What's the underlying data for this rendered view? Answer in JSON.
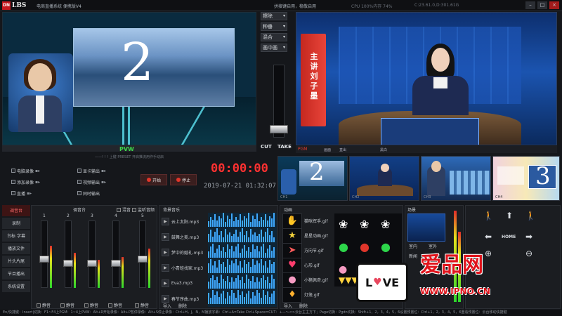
{
  "titlebar": {
    "logo_mark": "DN",
    "logo_text": "LBS",
    "system_name": "电商直播系统 便携版V4",
    "status_text": "拼接键启用，稳敬启用",
    "cpu_text": "CPU 100%内存 74%",
    "clock_text": "C:23.61.0,D:301.61G",
    "minimize": "–",
    "maximize": "□",
    "close": "×"
  },
  "preview": {
    "label": "PVW",
    "number": "2"
  },
  "switcher": {
    "dropdowns": [
      "擦除",
      "种垂",
      "混合",
      "画中画"
    ],
    "cut_label": "CUT",
    "take_label": "TAKE"
  },
  "program": {
    "banner_text": "主讲刘子墨",
    "bar_rec": "PGM",
    "bar_items": [
      "画面",
      "直出",
      "黑白"
    ]
  },
  "controls": {
    "info_line": "——! ! ! 上键 PRESET 开启推流用作手动启",
    "checks_left": [
      "电脑录像",
      "添加录像",
      "直播"
    ],
    "checks_right": [
      "显卡输出",
      "视频输出",
      "同时输出"
    ],
    "record_label": "开始",
    "stop_label": "停止",
    "timer": "00:00:00",
    "datetime": "2019-07-21 01:32:07"
  },
  "thumbnails": {
    "labels": [
      "CH1",
      "CH2",
      "CH3",
      "CH4"
    ],
    "numbers": [
      "2",
      "",
      "",
      "3"
    ]
  },
  "sidebar": {
    "items": [
      "调音台",
      "录制",
      "台标 字幕",
      "播放文件",
      "片头片尾",
      "节目播出",
      "系统设置"
    ]
  },
  "mixer": {
    "title": "调音台",
    "channel_numbers": [
      "1",
      "2",
      "3",
      "4",
      "5"
    ],
    "mute_label": "静音",
    "check_labels": [
      "混音",
      "监听音频"
    ]
  },
  "sounds": {
    "title": "背景音乐",
    "names": [
      "云上太阳.mp3",
      "鼓舞之美.mp3",
      "梦中的婚礼.mp3",
      "小青蛙找家.mp3",
      "Eva3.mp3",
      "春节序曲.mp3"
    ],
    "import": "导入",
    "delete": "删除"
  },
  "effects": {
    "title": "动画",
    "names": [
      "猫咪挥手.gif",
      "星星动画.gif",
      "方向节.gif",
      "心形.gif",
      "小猪佩奇.gif",
      "灯笼.gif"
    ],
    "import": "导入",
    "delete": "删除"
  },
  "scene": {
    "title": "场景",
    "btn_a": "室内",
    "btn_b": "室外",
    "btn_c": "新闻",
    "btn_d": "晚会"
  },
  "ptz": {
    "home": "HOME"
  },
  "watermark": {
    "brand": "爱品网",
    "url": "WWW.IPNO.CN",
    "love_l": "L",
    "love_ve": "VE"
  },
  "footer": {
    "text": "En/快捷键：Insert|切换：F1~F4上PGM：1~4上PVW：Alt+R开始录像：Alt+P暂停录像：Alt+S停止录像：Ctrl+H，J，N，M播放字幕：Ctrl+A=Take Ctrl+Space=CUT：+—～<>云台主主方下；Page切换：Pgdn切换：Shift+1，2，3，4，5，6设置预置位：Ctrl+1，2，3，4，5，6重看预置位：云台移动快捷键"
  },
  "colors": {
    "accent_red": "#ff3131",
    "pvw_green": "#3ed84a",
    "banner_red": "#c5281f"
  }
}
